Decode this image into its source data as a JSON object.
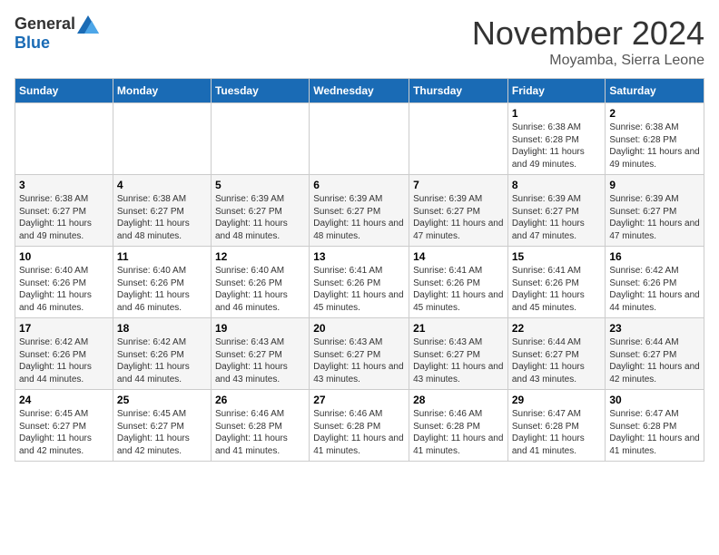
{
  "logo": {
    "general": "General",
    "blue": "Blue"
  },
  "title": "November 2024",
  "location": "Moyamba, Sierra Leone",
  "days": [
    "Sunday",
    "Monday",
    "Tuesday",
    "Wednesday",
    "Thursday",
    "Friday",
    "Saturday"
  ],
  "weeks": [
    [
      {
        "day": "",
        "info": ""
      },
      {
        "day": "",
        "info": ""
      },
      {
        "day": "",
        "info": ""
      },
      {
        "day": "",
        "info": ""
      },
      {
        "day": "",
        "info": ""
      },
      {
        "day": "1",
        "info": "Sunrise: 6:38 AM\nSunset: 6:28 PM\nDaylight: 11 hours and 49 minutes."
      },
      {
        "day": "2",
        "info": "Sunrise: 6:38 AM\nSunset: 6:28 PM\nDaylight: 11 hours and 49 minutes."
      }
    ],
    [
      {
        "day": "3",
        "info": "Sunrise: 6:38 AM\nSunset: 6:27 PM\nDaylight: 11 hours and 49 minutes."
      },
      {
        "day": "4",
        "info": "Sunrise: 6:38 AM\nSunset: 6:27 PM\nDaylight: 11 hours and 48 minutes."
      },
      {
        "day": "5",
        "info": "Sunrise: 6:39 AM\nSunset: 6:27 PM\nDaylight: 11 hours and 48 minutes."
      },
      {
        "day": "6",
        "info": "Sunrise: 6:39 AM\nSunset: 6:27 PM\nDaylight: 11 hours and 48 minutes."
      },
      {
        "day": "7",
        "info": "Sunrise: 6:39 AM\nSunset: 6:27 PM\nDaylight: 11 hours and 47 minutes."
      },
      {
        "day": "8",
        "info": "Sunrise: 6:39 AM\nSunset: 6:27 PM\nDaylight: 11 hours and 47 minutes."
      },
      {
        "day": "9",
        "info": "Sunrise: 6:39 AM\nSunset: 6:27 PM\nDaylight: 11 hours and 47 minutes."
      }
    ],
    [
      {
        "day": "10",
        "info": "Sunrise: 6:40 AM\nSunset: 6:26 PM\nDaylight: 11 hours and 46 minutes."
      },
      {
        "day": "11",
        "info": "Sunrise: 6:40 AM\nSunset: 6:26 PM\nDaylight: 11 hours and 46 minutes."
      },
      {
        "day": "12",
        "info": "Sunrise: 6:40 AM\nSunset: 6:26 PM\nDaylight: 11 hours and 46 minutes."
      },
      {
        "day": "13",
        "info": "Sunrise: 6:41 AM\nSunset: 6:26 PM\nDaylight: 11 hours and 45 minutes."
      },
      {
        "day": "14",
        "info": "Sunrise: 6:41 AM\nSunset: 6:26 PM\nDaylight: 11 hours and 45 minutes."
      },
      {
        "day": "15",
        "info": "Sunrise: 6:41 AM\nSunset: 6:26 PM\nDaylight: 11 hours and 45 minutes."
      },
      {
        "day": "16",
        "info": "Sunrise: 6:42 AM\nSunset: 6:26 PM\nDaylight: 11 hours and 44 minutes."
      }
    ],
    [
      {
        "day": "17",
        "info": "Sunrise: 6:42 AM\nSunset: 6:26 PM\nDaylight: 11 hours and 44 minutes."
      },
      {
        "day": "18",
        "info": "Sunrise: 6:42 AM\nSunset: 6:26 PM\nDaylight: 11 hours and 44 minutes."
      },
      {
        "day": "19",
        "info": "Sunrise: 6:43 AM\nSunset: 6:27 PM\nDaylight: 11 hours and 43 minutes."
      },
      {
        "day": "20",
        "info": "Sunrise: 6:43 AM\nSunset: 6:27 PM\nDaylight: 11 hours and 43 minutes."
      },
      {
        "day": "21",
        "info": "Sunrise: 6:43 AM\nSunset: 6:27 PM\nDaylight: 11 hours and 43 minutes."
      },
      {
        "day": "22",
        "info": "Sunrise: 6:44 AM\nSunset: 6:27 PM\nDaylight: 11 hours and 43 minutes."
      },
      {
        "day": "23",
        "info": "Sunrise: 6:44 AM\nSunset: 6:27 PM\nDaylight: 11 hours and 42 minutes."
      }
    ],
    [
      {
        "day": "24",
        "info": "Sunrise: 6:45 AM\nSunset: 6:27 PM\nDaylight: 11 hours and 42 minutes."
      },
      {
        "day": "25",
        "info": "Sunrise: 6:45 AM\nSunset: 6:27 PM\nDaylight: 11 hours and 42 minutes."
      },
      {
        "day": "26",
        "info": "Sunrise: 6:46 AM\nSunset: 6:28 PM\nDaylight: 11 hours and 41 minutes."
      },
      {
        "day": "27",
        "info": "Sunrise: 6:46 AM\nSunset: 6:28 PM\nDaylight: 11 hours and 41 minutes."
      },
      {
        "day": "28",
        "info": "Sunrise: 6:46 AM\nSunset: 6:28 PM\nDaylight: 11 hours and 41 minutes."
      },
      {
        "day": "29",
        "info": "Sunrise: 6:47 AM\nSunset: 6:28 PM\nDaylight: 11 hours and 41 minutes."
      },
      {
        "day": "30",
        "info": "Sunrise: 6:47 AM\nSunset: 6:28 PM\nDaylight: 11 hours and 41 minutes."
      }
    ]
  ]
}
